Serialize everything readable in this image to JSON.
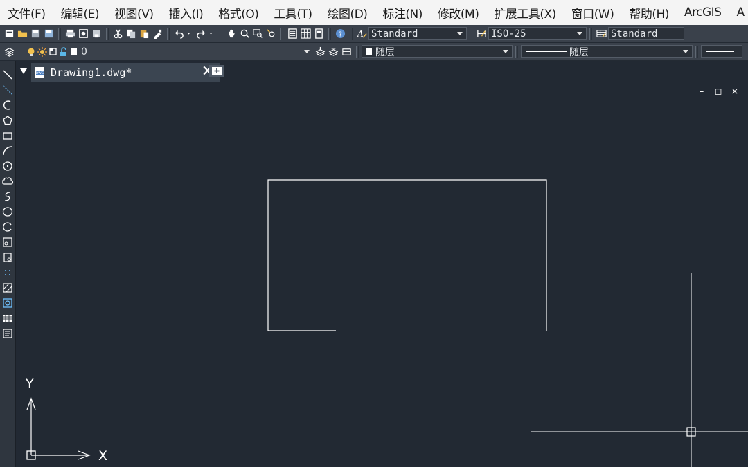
{
  "menubar": {
    "items": [
      "文件(F)",
      "编辑(E)",
      "视图(V)",
      "插入(I)",
      "格式(O)",
      "工具(T)",
      "绘图(D)",
      "标注(N)",
      "修改(M)",
      "扩展工具(X)",
      "窗口(W)",
      "帮助(H)",
      "ArcGIS",
      "A"
    ]
  },
  "toolbar1": {
    "text_style": "Standard",
    "dim_style": "ISO-25",
    "table_style": "Standard"
  },
  "toolbar2": {
    "layer_value": "0",
    "color_value": "随层",
    "linetype_value": "随层"
  },
  "tab": {
    "title": "Drawing1.dwg*",
    "close": "✕"
  },
  "window_controls": {
    "minimize": "–",
    "restore": "◻",
    "close": "×"
  },
  "ucs": {
    "x_label": "X",
    "y_label": "Y"
  },
  "colors": {
    "menubar_bg": "#f4f4f4",
    "canvas_bg": "#222933",
    "toolbar_bg": "#3a414b",
    "tab_bg": "#3b4551",
    "line_color": "#ffffff"
  }
}
